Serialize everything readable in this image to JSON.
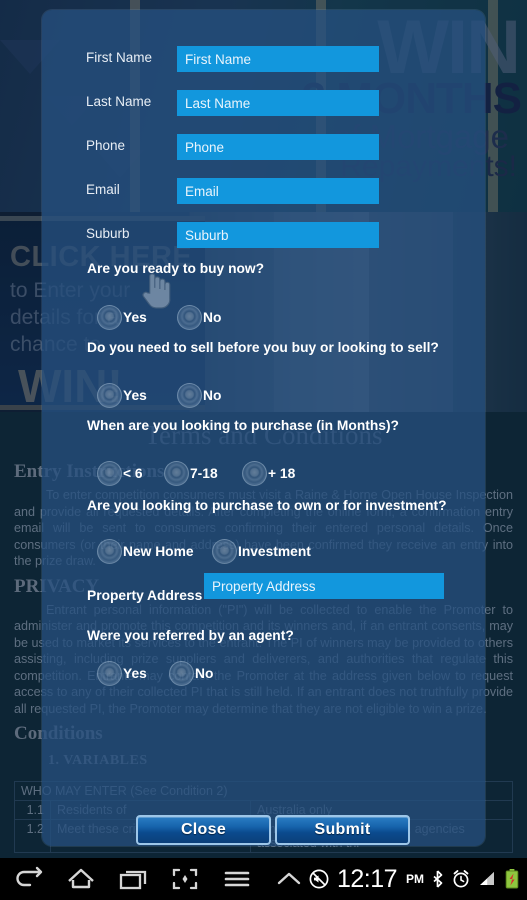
{
  "background": {
    "hero": {
      "win": "WIN",
      "months": "3 MONTHS",
      "mortgage": "of Mortgage",
      "repayments": "Repayments!"
    },
    "promo_panel": {
      "click_here": "CLICK HERE",
      "subtitle": "to Enter your\ndetails for a\nchance to",
      "win": "WIN!"
    },
    "terms": {
      "title": "Terms and Conditions",
      "entry_heading": "Entry Instructions",
      "entry_body": "To enter competition consumers must visit a Raine & Horne Open House Inspection and provide all requested details. After completing the online form, a confirmation entry email will be sent to consumers confirming their entered personal details. Once consumers (or their name and address) have been confirmed they receive an entry into the prize draw.",
      "privacy_heading": "PRIVACY",
      "privacy_body": "Entrant personal information (\"PI\") will be collected to enable the Promoter to administer and promote this competition and its winners and, if an entrant consents, may be used to market its services to the entrant. The PI of winners may be provided to others assisting, including prize suppliers and deliverers, and authorities that regulate this competition. Entrants may contact the Promoter at the address given below to request access to any of their collected PI that is still held. If an entrant does not truthfully provide all requested PI, the Promoter may determine that they are not eligible to win a prize.",
      "conditions_heading": "Conditions",
      "variables_item": "1.   VARIABLES",
      "table": {
        "header": "WHO MAY ENTER (See Condition 2)",
        "rows": [
          {
            "num": "1.1",
            "mid": "Residents of",
            "right": "Australia only"
          },
          {
            "num": "1.2",
            "mid": "Meet these criteria",
            "right": "Employees of the Promoter, agencies associated with thi"
          }
        ]
      }
    }
  },
  "dialog": {
    "fields": [
      {
        "label": "First Name",
        "placeholder": "First Name",
        "value": "",
        "name": "first-name"
      },
      {
        "label": "Last Name",
        "placeholder": "Last Name",
        "value": "",
        "name": "last-name"
      },
      {
        "label": "Phone",
        "placeholder": "Phone",
        "value": "",
        "name": "phone"
      },
      {
        "label": "Email",
        "placeholder": "Email",
        "value": "",
        "name": "email"
      },
      {
        "label": "Suburb",
        "placeholder": "Suburb",
        "value": "",
        "name": "suburb"
      }
    ],
    "questions": [
      {
        "text": "Are you ready to buy now?",
        "options": [
          {
            "label": "Yes"
          },
          {
            "label": "No"
          }
        ]
      },
      {
        "text": "Do you need to sell before you buy or looking to sell?",
        "options": [
          {
            "label": "Yes"
          },
          {
            "label": "No"
          }
        ]
      },
      {
        "text": "When are you looking to purchase (in Months)?",
        "options": [
          {
            "label": "< 6"
          },
          {
            "label": "7-18"
          },
          {
            "label": "+ 18"
          }
        ]
      },
      {
        "text": "Are you looking to purchase to own or for investment?",
        "options": [
          {
            "label": "New Home"
          },
          {
            "label": "Investment"
          }
        ]
      }
    ],
    "address": {
      "label": "Property Address",
      "placeholder": "Property Address",
      "value": ""
    },
    "agent_question": {
      "text": "Were you referred by an agent?",
      "options": [
        {
          "label": "Yes"
        },
        {
          "label": "No"
        }
      ]
    },
    "buttons": {
      "close": "Close",
      "submit": "Submit"
    },
    "colors": {
      "input_bg": "#1297dd",
      "dialog_bg": "#265080",
      "button_border": "#9dc6e8"
    }
  },
  "statusbar": {
    "time": "12:17",
    "ampm": "PM",
    "icons": [
      "mute-icon",
      "bluetooth-icon",
      "alarm-icon",
      "signal-icon",
      "battery-icon"
    ]
  },
  "navbar": {
    "items": [
      "back-icon",
      "home-icon",
      "recent-apps-icon",
      "screenshot-icon",
      "menu-icon",
      "collapse-icon"
    ]
  }
}
